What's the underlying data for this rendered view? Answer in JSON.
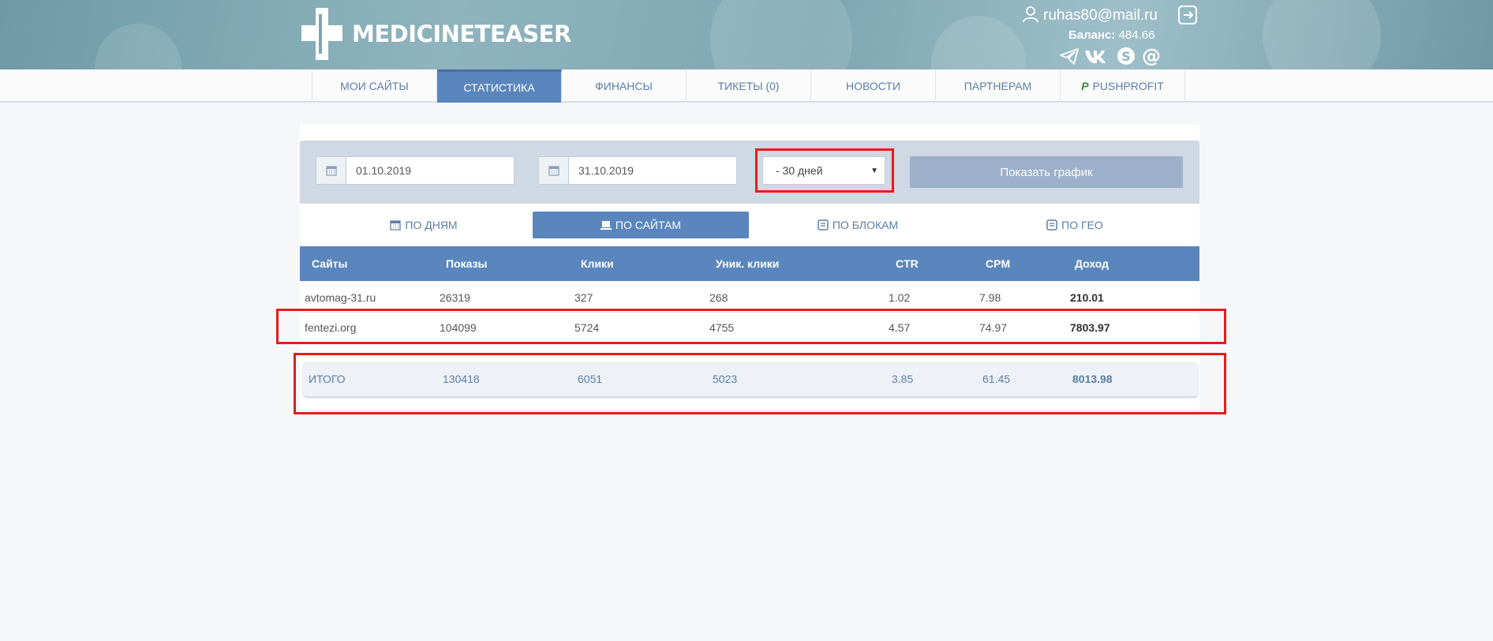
{
  "header": {
    "logo_text": "MEDICINETEASER",
    "user_email": "ruhas80@mail.ru",
    "balance_label": "Баланс:",
    "balance_value": "484.66"
  },
  "nav": [
    {
      "label": "МОИ САЙТЫ"
    },
    {
      "label": "СТАТИСТИКА",
      "active": true
    },
    {
      "label": "ФИНАНСЫ"
    },
    {
      "label": "ТИКЕТЫ (0)"
    },
    {
      "label": "НОВОСТИ"
    },
    {
      "label": "ПАРТНЕРАМ"
    },
    {
      "label": "PUSHPROFIT"
    }
  ],
  "filters": {
    "date_from": "01.10.2019",
    "date_to": "31.10.2019",
    "period": "- 30 дней",
    "show_chart_label": "Показать график"
  },
  "tabs": [
    {
      "label": "ПО ДНЯМ"
    },
    {
      "label": "ПО САЙТАМ",
      "active": true
    },
    {
      "label": "ПО БЛОКАМ"
    },
    {
      "label": "ПО ГЕО"
    }
  ],
  "table": {
    "columns": [
      "Сайты",
      "Показы",
      "Клики",
      "Уник. клики",
      "CTR",
      "CPM",
      "Доход"
    ],
    "rows": [
      [
        "avtomag-31.ru",
        "26319",
        "327",
        "268",
        "1.02",
        "7.98",
        "210.01"
      ],
      [
        "fentezi.org",
        "104099",
        "5724",
        "4755",
        "4.57",
        "74.97",
        "7803.97"
      ]
    ],
    "total": [
      "ИТОГО",
      "130418",
      "6051",
      "5023",
      "3.85",
      "61.45",
      "8013.98"
    ]
  },
  "colors": {
    "accent": "#5b86bd",
    "highlight": "#e51c1c",
    "filter_bar": "#cfd8e3"
  }
}
